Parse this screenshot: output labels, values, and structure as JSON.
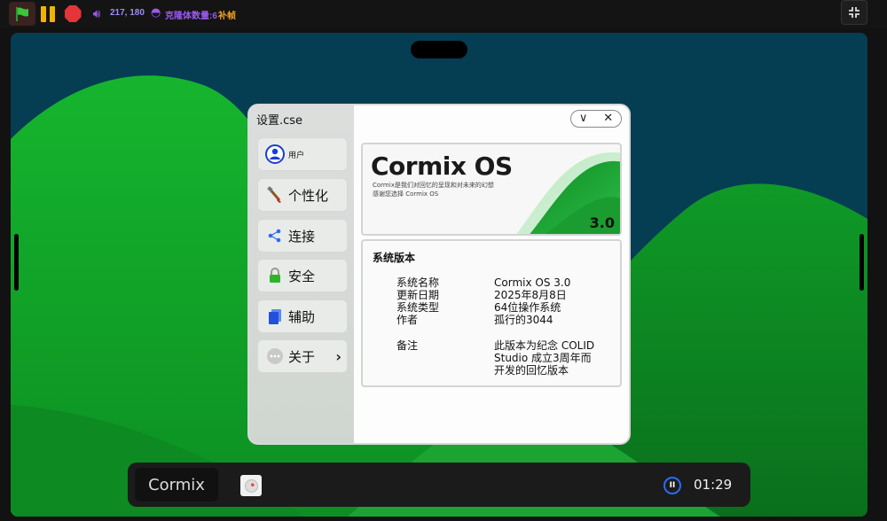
{
  "toolbar": {
    "coords": "217, 180",
    "clone_count": "克隆体数量:6",
    "frame_label": "补帧"
  },
  "window": {
    "title": "设置.cse",
    "nav": [
      {
        "label": "用户",
        "icon": "user-icon"
      },
      {
        "label": "个性化",
        "icon": "paint-brush-icon"
      },
      {
        "label": "连接",
        "icon": "share-nodes-icon"
      },
      {
        "label": "安全",
        "icon": "lock-icon"
      },
      {
        "label": "辅助",
        "icon": "accessibility-icon"
      },
      {
        "label": "关于",
        "icon": "more-dots-icon"
      }
    ],
    "controls": {
      "minimize": "∨",
      "close": "✕"
    },
    "banner": {
      "title": "Cormix OS",
      "subtitle_line1": "Cormix是我们对回忆的呈现和对未来的幻想",
      "subtitle_line2": "感谢您选择 Cormix OS",
      "version": "3.0"
    },
    "info": {
      "heading": "系统版本",
      "rows": [
        {
          "key": "系统名称",
          "value": "Cormix OS 3.0"
        },
        {
          "key": "更新日期",
          "value": "2025年8月8日"
        },
        {
          "key": "系统类型",
          "value": "64位操作系统"
        },
        {
          "key": "作者",
          "value": "孤行的3044"
        }
      ],
      "note_key": "备注",
      "note_lines": [
        "此版本为纪念 COLID",
        "Studio 成立3周年而",
        "开发的回忆版本"
      ]
    }
  },
  "taskbar": {
    "brand": "Cormix",
    "time": "01:29"
  },
  "colors": {
    "accent_blue": "#2a6df0",
    "hill_green": "#11a82a",
    "sky": "#053d52"
  }
}
